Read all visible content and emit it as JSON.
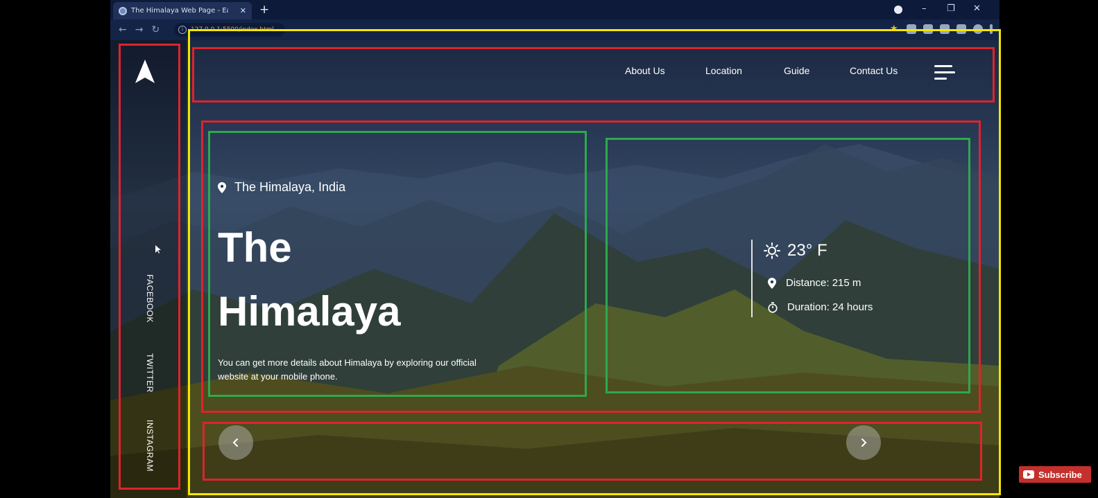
{
  "browser": {
    "tab_title": "The Himalaya Web Page - Easy T",
    "tab_close": "✕",
    "new_tab": "+",
    "address": "127.0.0.1:5500/index.html",
    "info_icon": "i",
    "window_controls": [
      "–",
      "❐",
      "✕"
    ]
  },
  "sidebar": {
    "logo": "navigation-arrow-icon",
    "social": [
      "FACEBOOK",
      "TWITTER",
      "INSTAGRAM"
    ]
  },
  "navbar": {
    "links": [
      "About Us",
      "Location",
      "Guide",
      "Contact Us"
    ],
    "menu_icon": "hamburger-menu-icon"
  },
  "hero": {
    "location": "The Himalaya, India",
    "title_line1": "The",
    "title_line2": "Himalaya",
    "description": "You can get more details about Himalaya by exploring our official website at your mobile phone."
  },
  "info": {
    "temperature": "23° F",
    "distance": "Distance: 215 m",
    "duration": "Duration: 24 hours"
  },
  "controls": {
    "prev_icon": "chevron-left-icon",
    "next_icon": "chevron-right-icon"
  },
  "subscribe": {
    "label": "Subscribe"
  },
  "colors": {
    "annotation_red": "#e0232b",
    "annotation_green": "#2fa84f",
    "annotation_yellow": "#f3e800",
    "subscribe_red": "#c4302b"
  }
}
